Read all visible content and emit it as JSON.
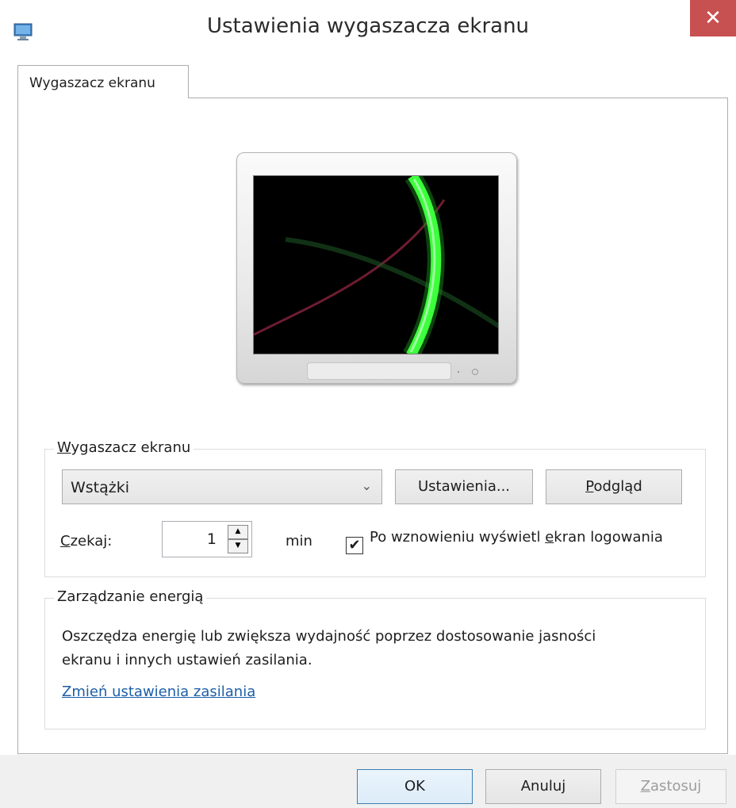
{
  "window": {
    "title": "Ustawienia wygaszacza ekranu",
    "close_glyph": "✕"
  },
  "tabs": [
    {
      "label": "Wygaszacz ekranu",
      "selected": true
    }
  ],
  "screensaver_group": {
    "title_prefix": "W",
    "title_rest": "ygaszacz ekranu",
    "selected_screensaver": "Wstążki",
    "settings_button": "Ustawienia...",
    "preview_button_prefix": "P",
    "preview_button_rest": "odgląd",
    "wait_label_prefix": "C",
    "wait_label_rest": "zekaj:",
    "wait_value": "1",
    "wait_unit": "min",
    "logon_checked": true,
    "logon_label_part1": "Po wznowieniu wyświetl ",
    "logon_label_accel": "e",
    "logon_label_part2": "kran logowania"
  },
  "power_group": {
    "title": "Zarządzanie energią",
    "description": "Oszczędza energię lub zwiększa wydajność poprzez dostosowanie jasności ekranu i innych ustawień zasilania.",
    "link": "Zmień ustawienia zasilania"
  },
  "footer": {
    "ok": "OK",
    "cancel": "Anuluj",
    "apply_prefix": "Z",
    "apply_rest": "astosuj"
  },
  "colors": {
    "close_button": "#c75050",
    "link": "#1c5ea8",
    "ribbon_green": "#3cff3c",
    "ribbon_red": "#7a1f35"
  },
  "icons": {
    "app": "screensaver-monitor-icon",
    "dropdown": "chevron-down-icon",
    "spin_up": "arrow-up-icon",
    "spin_down": "arrow-down-icon",
    "check": "checkmark-icon"
  }
}
